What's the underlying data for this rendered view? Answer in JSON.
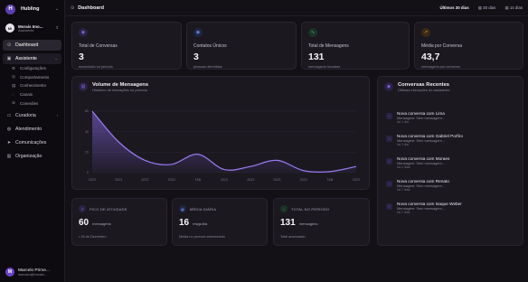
{
  "brand": {
    "name": "Hubling",
    "logo": "H"
  },
  "workspace": {
    "name": "Morais Imo...",
    "role": "Assistente",
    "initials": "MI"
  },
  "nav": {
    "dashboard": "Dashboard",
    "assistente": "Assistente",
    "sub": [
      "Configurações",
      "Comportamento",
      "Conhecimento",
      "Canais",
      "Conexões"
    ],
    "curadoria": "Curadoria",
    "atendimento": "Atendimento",
    "comunicacoes": "Comunicações",
    "organizacao": "Organização"
  },
  "user": {
    "name": "Marcelo Prime...",
    "email": "marcelo@morais...",
    "initials": "M"
  },
  "header": {
    "title": "Dashboard",
    "period_selected": "Últimos 30 dias",
    "period_opt1": "30 dias",
    "period_opt2": "14 dias"
  },
  "stats": [
    {
      "label": "Total de Conversas",
      "value": "3",
      "sub": "acumulado no período",
      "color": "#8b6cf0"
    },
    {
      "label": "Contatos Únicos",
      "value": "3",
      "sub": "pessoas atendidas",
      "color": "#6b8cf5"
    },
    {
      "label": "Total de Mensagens",
      "value": "131",
      "sub": "mensagens trocadas",
      "color": "#4fd18b"
    },
    {
      "label": "Média por Conversa",
      "value": "43,7",
      "sub": "mensagens por conversa",
      "color": "#f0a23a"
    }
  ],
  "chart": {
    "title": "Volume de Mensagens",
    "subtitle": "Histórico de interações no período"
  },
  "chart_data": {
    "type": "area",
    "title": "Volume de Mensagens",
    "x": [
      "2023",
      "2023",
      "2023",
      "2023",
      "TAB",
      "2023",
      "2023",
      "2023",
      "2023",
      "TAB",
      "2023"
    ],
    "values": [
      60,
      30,
      12,
      8,
      18,
      3,
      6,
      12,
      2,
      1,
      6
    ],
    "yticks": [
      "60",
      "40",
      "20",
      "0"
    ],
    "ylim": [
      0,
      60
    ],
    "color": "#8b6cf0"
  },
  "conversations": {
    "title": "Conversas Recentes",
    "subtitle": "Últimas interações do assistente",
    "items": [
      {
        "title": "Nova conversa com Lima",
        "msg": "Mensagem: Sem mensagem...",
        "time": "há 1 dia"
      },
      {
        "title": "Nova conversa com Gabriel Porfiro",
        "msg": "Mensagem: Sem mensagem...",
        "time": "há 1 dia"
      },
      {
        "title": "Nova conversa com Moraes",
        "msg": "Mensagem: Sem mensagem...",
        "time": "há 2 dias"
      },
      {
        "title": "Nova conversa com Renato",
        "msg": "Mensagem: Sem mensagem...",
        "time": "há 7 dias"
      },
      {
        "title": "Nova conversa com Isaque Weber",
        "msg": "Mensagem: Sem mensagem...",
        "time": "há 7 dias"
      }
    ]
  },
  "mini": [
    {
      "badge": "PICO DE ATIVIDADE",
      "value": "60",
      "unit": "mensagens",
      "sub": "• 28 de Dezembro",
      "color": "#8b6cf0"
    },
    {
      "badge": "MÉDIA DIÁRIA",
      "value": "16",
      "unit": "msgs/dia",
      "sub": "Média no período selecionado",
      "color": "#6b8cf5"
    },
    {
      "badge": "TOTAL NO PERÍODO",
      "value": "131",
      "unit": "mensagens",
      "sub": "Total acumulado",
      "color": "#4fd18b"
    }
  ]
}
